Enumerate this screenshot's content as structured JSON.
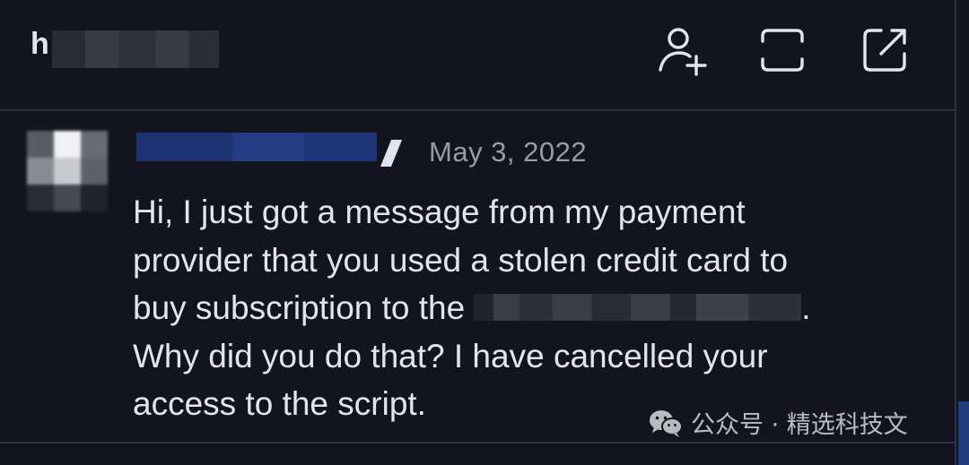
{
  "header": {
    "channel_initial": "h",
    "add_member_icon": "user-plus-icon",
    "fullscreen_icon": "frame-icon",
    "open_external_icon": "external-link-icon"
  },
  "message": {
    "timestamp": "May 3, 2022",
    "lines": [
      "Hi, I just got a message from my payment",
      "provider that you used a stolen credit card to",
      "buy subscription to the",
      "Why did you do that? I have cancelled your",
      "access to the script."
    ],
    "line3_suffix": "."
  },
  "watermark": {
    "text": "公众号 · 精选科技文",
    "icon": "wechat-icon"
  },
  "colors": {
    "background": "#13141f",
    "divider": "#30323f",
    "text": "#e4e5ec",
    "muted": "#9a9ba6",
    "author_redaction": "#1d3270"
  }
}
